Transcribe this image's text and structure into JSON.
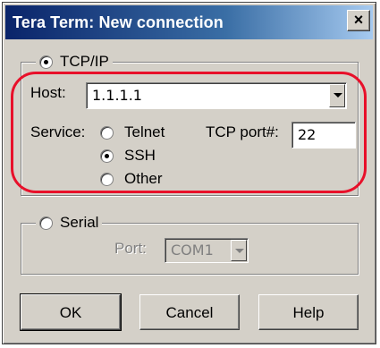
{
  "window": {
    "title": "Tera Term: New connection",
    "close_glyph": "×"
  },
  "tcpip": {
    "label": "TCP/IP",
    "selected": true,
    "host_label": "Host:",
    "host_value": "1.1.1.1",
    "service_label": "Service:",
    "services": [
      {
        "label": "Telnet",
        "selected": false
      },
      {
        "label": "SSH",
        "selected": true
      },
      {
        "label": "Other",
        "selected": false
      }
    ],
    "port_label": "TCP port#:",
    "port_value": "22"
  },
  "serial": {
    "label": "Serial",
    "selected": false,
    "port_label": "Port:",
    "port_value": "COM1"
  },
  "buttons": {
    "ok": "OK",
    "cancel": "Cancel",
    "help": "Help"
  },
  "colors": {
    "highlight_annotation": "#e8102a",
    "titlebar": "#0a246a",
    "dialog_face": "#d4d0c8"
  },
  "icons": {
    "close": "close-icon",
    "dropdown": "chevron-down-icon"
  }
}
